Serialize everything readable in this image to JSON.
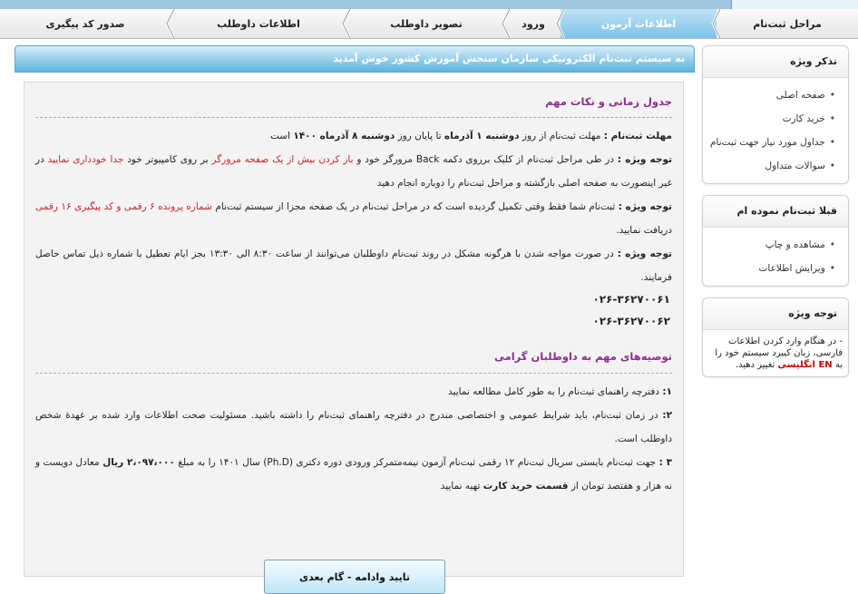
{
  "tabs": [
    "مراحل ثبت‌نام",
    "اطلاعات آزمون",
    "ورود",
    "تصویر داوطلب",
    "اطلاعات داوطلب",
    "صدور کد پیگیری"
  ],
  "active_tab": "اطلاعات آزمون",
  "sidebar": {
    "box1": {
      "title": "تذکر ویژه",
      "items": [
        "صفحه اصلی",
        "خرید کارت",
        "جداول مورد نیاز جهت ثبت‌نام",
        "سوالات متداول"
      ]
    },
    "box2": {
      "title": "قبلا ثبت‌نام نموده ام",
      "items": [
        "مشاهده و چاپ",
        "ویرایش اطلاعات"
      ]
    },
    "box3": {
      "title": "توجه ویژه",
      "note_before": "- در هنگام وارد کردن اطلاعات فارسی، زبان کیبرد سیستم خود را به",
      "note_en": "EN انگلیسی",
      "note_after": "تغییر دهید."
    }
  },
  "main": {
    "welcome": "به سیستم ثبت‌نام الکترونیکی سازمان سنجش آموزش کشور خوش آمدید",
    "section1": {
      "title": "جدول زمانی و نکات مهم",
      "deadline": {
        "label": "مهلت ثبت‌نام :",
        "t1": "مهلت ثبت‌نام از روز",
        "d1": "دوشنبه ۱ آذرماه",
        "t2": "تا پایان روز",
        "d2": "دوشنبه ۸ آذرماه ۱۴۰۰",
        "t3": "است"
      },
      "note1": {
        "label": "توجه ویژه :",
        "t1": "در طی مراحل ثبت‌نام از کلیک برروی دکمه",
        "back": "Back",
        "t2": "مرورگر خود و",
        "r1": "باز کردن بیش از یک صفحه مرورگر",
        "t3": "بر روی کامپیوتر خود",
        "r2": "جدا خودداری نمایید",
        "t4": "در غیر اینصورت به صفحه اصلی بازگشته و مراحل ثبت‌نام را دوباره انجام دهید"
      },
      "note2": {
        "label": "توجه ویژه :",
        "t1": "ثبت‌نام شما فقط وقتی تکمیل گردیده است که در مراحل ثبت‌نام در یک صفحه مجزا از سیستم ثبت‌نام",
        "r1": "شماره پرونده ۶ رقمی و کد پیگیری ۱۶ رقمی",
        "t2": "دریافت نمایید."
      },
      "note3": {
        "label": "توجه ویژه :",
        "t1": "در صورت مواجه شدن با هرگونه مشکل در روند ثبت‌نام داوطلبان می‌توانند از ساعت ۸:۳۰ الی ۱۳:۳۰ بجز ایام تعطیل با شماره ذیل تماس حاصل فرمایند."
      },
      "phones": [
        "۰۲۶-۳۶۲۷۰۰۶۱",
        "۰۲۶-۳۶۲۷۰۰۶۲"
      ]
    },
    "section2": {
      "title": "توصیه‌های مهم به داوطلبان گرامی",
      "item1": {
        "num": "۱:",
        "text": "دفترچه راهنمای ثبت‌نام را به طور کامل مطالعه نمایید"
      },
      "item2": {
        "num": "۲:",
        "text": "در زمان ثبت‌نام، باید شرایط عمومی و اختصاصی مندرج در دفترچه راهنمای ثبت‌نام را داشته باشید. مسئولیت صحت اطلاعات وارد شده بر عهدهٔ شخص داوطلب است."
      },
      "item3": {
        "num": "۳ :",
        "t1": "جهت ثبت‌نام بایستی سریال ثبت‌نام ۱۲ رقمی ثبت‌نام آزمون نیمه‌متمرکز ورودی دوره دکتری (Ph.D) سال ۱۴۰۱ را به مبلغ",
        "amount": "۲،۰۹۷،۰۰۰ ریال",
        "t2": "معادل دویست و نه هزار و هفتصد تومان از",
        "link": "قسمت خرید کارت",
        "t3": "تهیه نمایید"
      }
    },
    "button": "تایید وادامه - گام بعدی"
  }
}
